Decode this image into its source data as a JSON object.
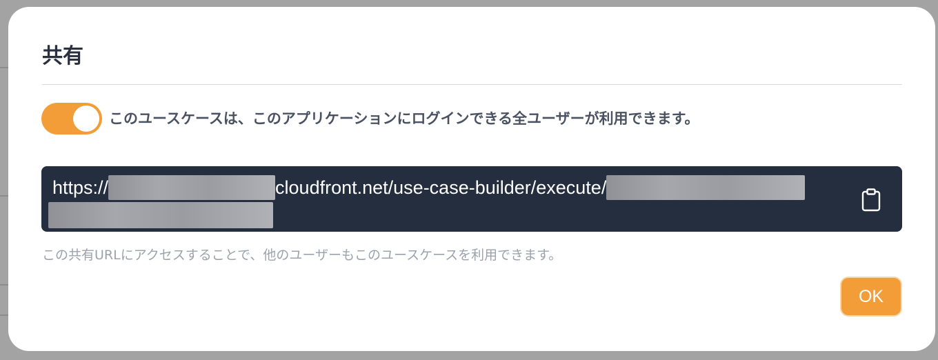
{
  "dialog": {
    "title": "共有",
    "toggle": {
      "on": true,
      "label": "このユースケースは、このアプリケーションにログインできる全ユーザーが利用できます。"
    },
    "share_url": {
      "prefix": "https://",
      "middle": "cloudfront.net/use-case-builder/execute/",
      "copy_icon": "clipboard-icon"
    },
    "helper_text": "この共有URLにアクセスすることで、他のユーザーもこのユースケースを利用できます。",
    "ok_label": "OK"
  },
  "colors": {
    "accent": "#f29d38",
    "url_background": "#242e3e",
    "title_text": "#2a3040",
    "helper_text": "#9ca1ab"
  }
}
